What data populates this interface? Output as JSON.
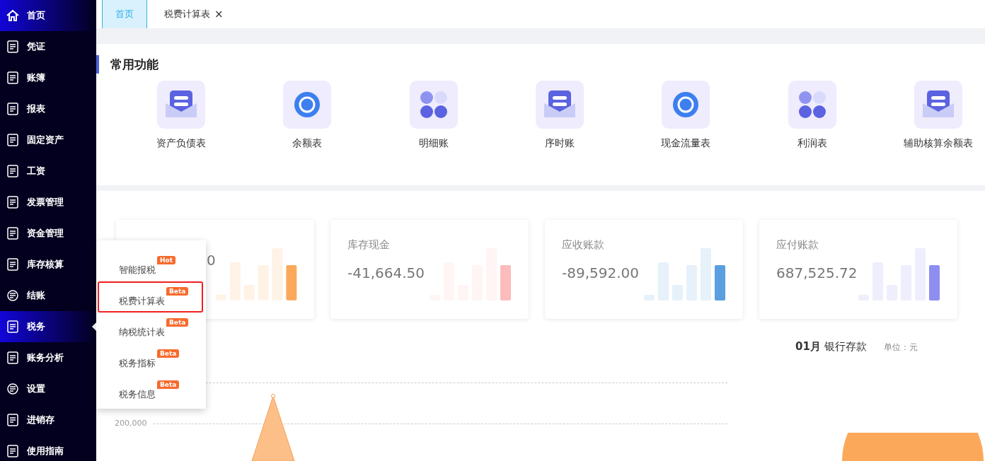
{
  "sidebar": {
    "items": [
      {
        "label": "首页",
        "selected": true,
        "expanded": false
      },
      {
        "label": "凭证",
        "selected": false,
        "expanded": false
      },
      {
        "label": "账簿",
        "selected": false,
        "expanded": false
      },
      {
        "label": "报表",
        "selected": false,
        "expanded": false
      },
      {
        "label": "固定资产",
        "selected": false,
        "expanded": false
      },
      {
        "label": "工资",
        "selected": false,
        "expanded": false
      },
      {
        "label": "发票管理",
        "selected": false,
        "expanded": false
      },
      {
        "label": "资金管理",
        "selected": false,
        "expanded": false
      },
      {
        "label": "库存核算",
        "selected": false,
        "expanded": false
      },
      {
        "label": "结账",
        "selected": false,
        "expanded": false
      },
      {
        "label": "税务",
        "selected": true,
        "expanded": true
      },
      {
        "label": "账务分析",
        "selected": false,
        "expanded": false
      },
      {
        "label": "设置",
        "selected": false,
        "expanded": false
      },
      {
        "label": "进销存",
        "selected": false,
        "expanded": false
      },
      {
        "label": "使用指南",
        "selected": false,
        "expanded": false
      }
    ]
  },
  "tabs": [
    {
      "label": "首页",
      "selected": true
    },
    {
      "label": "税费计算表",
      "selected": false,
      "close": "×"
    }
  ],
  "common_functions": {
    "title": "常用功能",
    "items": [
      {
        "label": "资产负债表"
      },
      {
        "label": "余额表"
      },
      {
        "label": "明细账"
      },
      {
        "label": "序时账"
      },
      {
        "label": "现金流量表"
      },
      {
        "label": "利润表"
      },
      {
        "label": "辅助核算余额表"
      }
    ]
  },
  "stat_cards": [
    {
      "kind": "obscured",
      "value": "0",
      "color": "#fca85a"
    },
    {
      "kind": "full",
      "title": "库存现金",
      "value": "-41,664.50",
      "color": "#fcbcbc"
    },
    {
      "kind": "full",
      "title": "应收账款",
      "value": "-89,592.00",
      "color": "#5a9fe0"
    },
    {
      "kind": "full",
      "title": "应付账款",
      "value": "687,525.72",
      "color": "#8e8ef0"
    }
  ],
  "chart_panel": {
    "month": "01月",
    "title": "银行存款",
    "unit": "单位：元",
    "y_label": "200,000"
  },
  "tax_menu": {
    "items": [
      {
        "label": "智能报税",
        "badge": "Hot",
        "selected": false
      },
      {
        "label": "税费计算表",
        "badge": "Beta",
        "selected": true
      },
      {
        "label": "纳税统计表",
        "badge": "Beta",
        "selected": false
      },
      {
        "label": "税务指标",
        "badge": "Beta",
        "selected": false
      },
      {
        "label": "税务信息",
        "badge": "Beta",
        "selected": false
      }
    ]
  }
}
